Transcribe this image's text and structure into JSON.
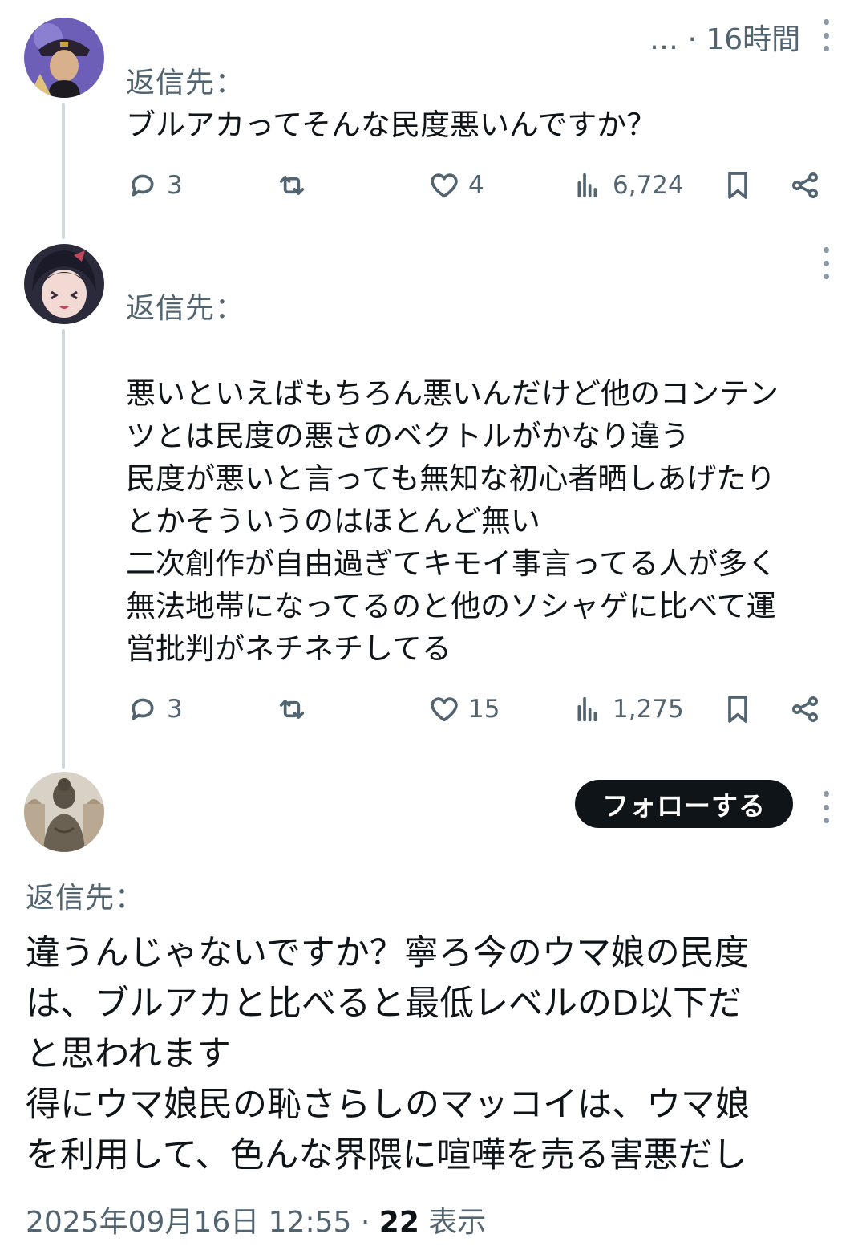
{
  "posts": [
    {
      "time": "… · 16時間",
      "reply_to": "返信先：",
      "text": "ブルアカってそんな民度悪いんですか？",
      "replies": "3",
      "likes": "4",
      "views": "6,724",
      "avatar_icon": "character-avatar-hat"
    },
    {
      "reply_to": "返信先：",
      "text": "悪いといえばもちろん悪いんだけど他のコンテン\nツとは民度の悪さのベクトルがかなり違う\n民度が悪いと言っても無知な初心者晒しあげたり\nとかそういうのはほとんど無い\n二次創作が自由過ぎてキモイ事言ってる人が多く\n無法地帯になってるのと他のソシャゲに比べて運\n営批判がネチネチしてる",
      "replies": "3",
      "likes": "15",
      "views": "1,275",
      "avatar_icon": "anime-girl-avatar"
    },
    {
      "follow_label": "フォローする",
      "reply_to": "返信先：",
      "text": "違うんじゃないですか？寧ろ今のウマ娘の民度\nは、ブルアカと比べると最低レベルのD以下だ\nと思われます\n得にウマ娘民の恥さらしのマッコイは、ウマ娘\nを利用して、色んな界隈に喧嘩を売る害悪だし",
      "date": "2025年09月16日 12:55 · ",
      "view_count": "22",
      "view_label": " 表示",
      "avatar_icon": "buddha-statue-avatar"
    }
  ],
  "colors": {
    "text": "#0f1419",
    "secondary": "#536471",
    "thread": "#cfd9de",
    "button": "#0f1419"
  }
}
